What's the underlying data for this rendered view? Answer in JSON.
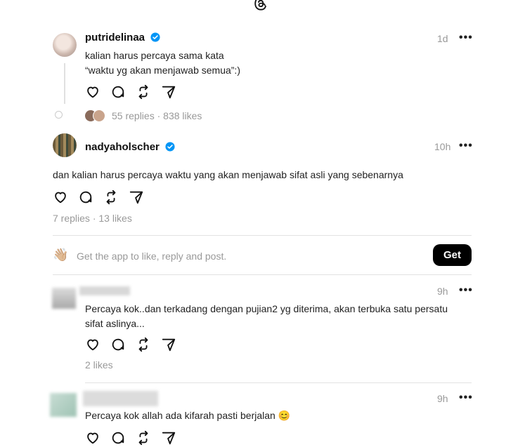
{
  "post1": {
    "username": "putridelinaa",
    "time": "1d",
    "text_line1": "kalian harus percaya sama kata",
    "text_line2": "“waktu yg akan menjawab semua”:)",
    "replies": "55 replies",
    "likes": "838 likes",
    "separator": "·"
  },
  "post2": {
    "username": "nadyaholscher",
    "time": "10h",
    "text": "dan kalian harus percaya waktu yang akan menjawab sifat asli yang sebenarnya",
    "replies": "7 replies",
    "likes": "13 likes",
    "separator": "·"
  },
  "app_prompt": {
    "emoji": "👋🏼",
    "text": "Get the app to like, reply and post.",
    "button": "Get"
  },
  "post3": {
    "time": "9h",
    "text_line1": "Percaya kok..dan terkadang dengan pujian2 yg diterima, akan terbuka satu persatu",
    "text_line2": "sifat aslinya...",
    "likes": "2 likes"
  },
  "post4": {
    "time": "9h",
    "text": "Percaya kok allah ada kifarah pasti berjalan 😊"
  },
  "more_label": "•••",
  "colors": {
    "verified": "#0095f6",
    "muted": "#999999",
    "button_bg": "#000000"
  }
}
